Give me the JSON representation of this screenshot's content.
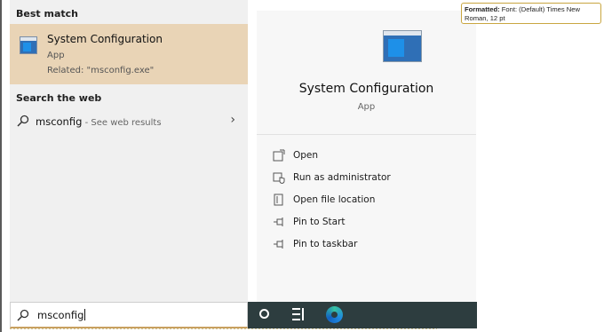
{
  "left": {
    "best_match_heading": "Best match",
    "best_match": {
      "title": "System Configuration",
      "type": "App",
      "related": "Related: \"msconfig.exe\""
    },
    "search_web_heading": "Search the web",
    "web_result": {
      "query": "msconfig",
      "suffix": " - See web results"
    }
  },
  "detail": {
    "title": "System Configuration",
    "type": "App",
    "actions": [
      {
        "label": "Open",
        "icon": "open-icon"
      },
      {
        "label": "Run as administrator",
        "icon": "shield-icon"
      },
      {
        "label": "Open file location",
        "icon": "file-location-icon"
      },
      {
        "label": "Pin to Start",
        "icon": "pin-icon"
      },
      {
        "label": "Pin to taskbar",
        "icon": "pin-icon"
      }
    ]
  },
  "search": {
    "value": "msconfig"
  },
  "taskbar": {
    "items": [
      "cortana-icon",
      "task-view-icon",
      "edge-icon"
    ]
  },
  "comment": {
    "label": "Formatted:",
    "text": " Font: (Default) Times New Roman, 12 pt"
  },
  "colors": {
    "highlight": "#e9d4b6",
    "taskbar": "#2d3d3f",
    "comment_border": "#c9a640"
  }
}
